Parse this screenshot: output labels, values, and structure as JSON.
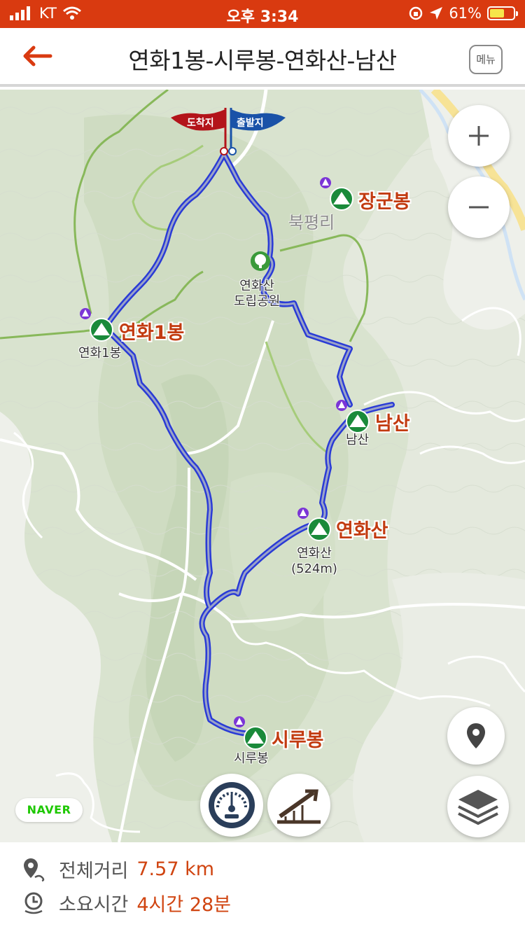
{
  "status_bar": {
    "carrier": "KT",
    "time": "오후 3:34",
    "battery": "61%",
    "battery_level": 0.61
  },
  "header": {
    "title": "연화1봉-시루봉-연화산-남산",
    "menu_label": "메뉴"
  },
  "map": {
    "flags": {
      "arrival": "도착지",
      "departure": "출발지"
    },
    "peaks": [
      {
        "name": "장군봉"
      },
      {
        "name": "연화1봉",
        "sub": "연화1봉"
      },
      {
        "name": "남산",
        "sub": "남산"
      },
      {
        "name": "연화산",
        "sub": "연화산",
        "sub2": "(524m)"
      },
      {
        "name": "시루봉",
        "sub": "시루봉"
      }
    ],
    "village": "북평리",
    "park": {
      "line1": "연화산",
      "line2": "도립공원"
    },
    "naver_badge": "NAVER"
  },
  "info": {
    "distance_label": "전체거리",
    "distance_value": "7.57 km",
    "time_label": "소요시간",
    "time_value": "4시간 28분"
  },
  "colors": {
    "status_bar": "#d93a10",
    "accent_text": "#d04410",
    "route": "#2a3bd6",
    "peak_icon": "#1a8a3a",
    "arrival_flag": "#b3141a",
    "departure_flag": "#1a52a8"
  }
}
